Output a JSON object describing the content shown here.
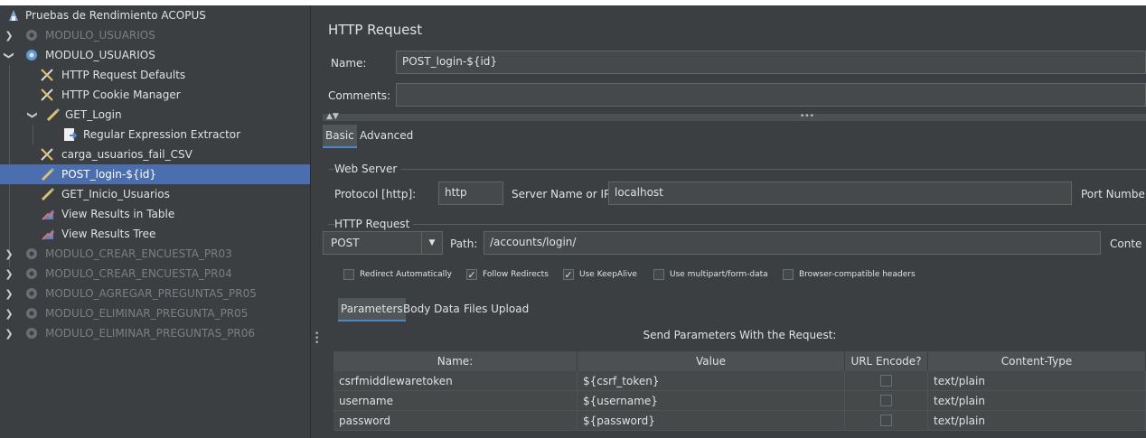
{
  "tree": {
    "root_label": "Pruebas de Rendimiento ACOPUS",
    "items": [
      {
        "label": "MODULO_USUARIOS",
        "disabled": true
      },
      {
        "label": "MODULO_USUARIOS",
        "disabled": false
      },
      {
        "label": "HTTP Request Defaults"
      },
      {
        "label": "HTTP Cookie Manager"
      },
      {
        "label": "GET_Login"
      },
      {
        "label": "Regular Expression Extractor"
      },
      {
        "label": "carga_usuarios_fail_CSV"
      },
      {
        "label": "POST_login-${id}",
        "selected": true
      },
      {
        "label": "GET_Inicio_Usuarios"
      },
      {
        "label": "View Results in Table"
      },
      {
        "label": "View Results Tree"
      },
      {
        "label": "MODULO_CREAR_ENCUESTA_PR03",
        "disabled": true
      },
      {
        "label": "MODULO_CREAR_ENCUESTA_PR04",
        "disabled": true
      },
      {
        "label": "MODULO_AGREGAR_PREGUNTAS_PR05",
        "disabled": true
      },
      {
        "label": "MODULO_ELIMINAR_PREGUNTA_PR05",
        "disabled": true
      },
      {
        "label": "MODULO_ELIMINAR_PREGUNTAS_PR06",
        "disabled": true
      }
    ]
  },
  "panel": {
    "title": "HTTP Request",
    "name_label": "Name:",
    "name_value": "POST_login-${id}",
    "comments_label": "Comments:",
    "comments_value": "",
    "collapse_arrows": "▲▼",
    "collapse_dots": "•••",
    "tabs": [
      "Basic",
      "Advanced"
    ],
    "web_server": {
      "group_label": "Web Server",
      "protocol_label": "Protocol [http]:",
      "protocol_value": "http",
      "server_label": "Server Name or IP:",
      "server_value": "localhost",
      "port_label": "Port Numbe"
    },
    "http_request": {
      "group_label": "HTTP Request",
      "method": "POST",
      "path_label": "Path:",
      "path_value": "/accounts/login/",
      "content_label": "Conte"
    },
    "checkboxes": [
      {
        "label": "Redirect Automatically",
        "checked": false
      },
      {
        "label": "Follow Redirects",
        "checked": true
      },
      {
        "label": "Use KeepAlive",
        "checked": true
      },
      {
        "label": "Use multipart/form-data",
        "checked": false
      },
      {
        "label": "Browser-compatible headers",
        "checked": false
      }
    ],
    "subtabs": [
      "Parameters",
      "Body Data",
      "Files Upload"
    ],
    "params_caption": "Send Parameters With the Request:",
    "params_headers": [
      "Name:",
      "Value",
      "URL Encode?",
      "Content-Type"
    ],
    "params_rows": [
      {
        "name": "csrfmiddlewaretoken",
        "value": "${csrf_token}",
        "url_encode": false,
        "content_type": "text/plain"
      },
      {
        "name": "username",
        "value": "${username}",
        "url_encode": false,
        "content_type": "text/plain"
      },
      {
        "name": "password",
        "value": "${password}",
        "url_encode": false,
        "content_type": "text/plain"
      }
    ]
  },
  "colors": {
    "background": "#3c3f41",
    "selection": "#4b6eaf",
    "field": "#45494a",
    "header": "#4c5052"
  }
}
